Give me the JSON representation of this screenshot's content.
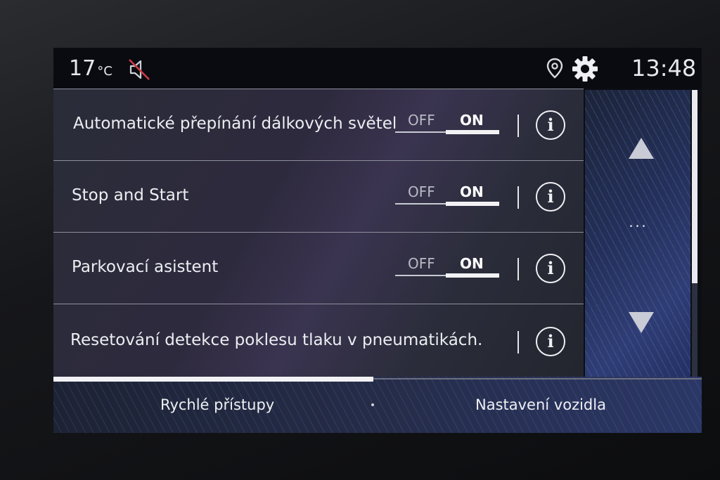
{
  "status": {
    "temperature": "17",
    "temperature_unit": "°C",
    "time": "13:48",
    "icons": [
      "mute-icon",
      "location-icon",
      "gear-icon"
    ]
  },
  "settings": {
    "rows": [
      {
        "label": "Automatické přepínání dálkových světel",
        "toggle": true,
        "off": "OFF",
        "on": "ON",
        "state": "ON"
      },
      {
        "label": "Stop and Start",
        "toggle": true,
        "off": "OFF",
        "on": "ON",
        "state": "ON"
      },
      {
        "label": "Parkovací asistent",
        "toggle": true,
        "off": "OFF",
        "on": "ON",
        "state": "ON"
      },
      {
        "label": "Resetování detekce poklesu tlaku v pneumatikách.",
        "toggle": false
      }
    ],
    "info_glyph": "i"
  },
  "scroll": {
    "more": "..."
  },
  "tabs": [
    {
      "label": "Rychlé přístupy",
      "active": true
    },
    {
      "label": "Nastavení vozidla",
      "active": false
    }
  ],
  "colors": {
    "accent": "#f2f2f4",
    "mute_slash": "#d23c4a",
    "panel_blue": "#2f3d75"
  }
}
